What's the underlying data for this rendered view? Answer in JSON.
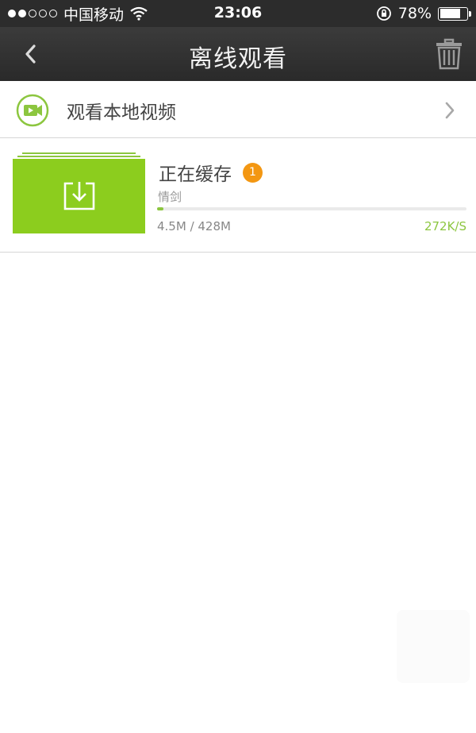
{
  "status_bar": {
    "carrier": "中国移动",
    "time": "23:06",
    "battery": "78%",
    "battery_level": 0.78
  },
  "nav": {
    "title": "离线观看",
    "back_icon": "chevron-left-icon",
    "trash_icon": "trash-icon"
  },
  "local_video": {
    "label": "观看本地视频",
    "icon": "video-camera-icon"
  },
  "download": {
    "title": "正在缓存",
    "badge_count": "1",
    "video_name": "情剑",
    "size_text": "4.5M / 428M",
    "speed": "272K/S",
    "progress": 0.0105,
    "thumb_icon": "download-icon"
  },
  "colors": {
    "accent_green": "#8cc63f",
    "thumb_green": "#8ccd1e",
    "badge_orange": "#f39712",
    "header_dark": "#2c2c2c"
  }
}
